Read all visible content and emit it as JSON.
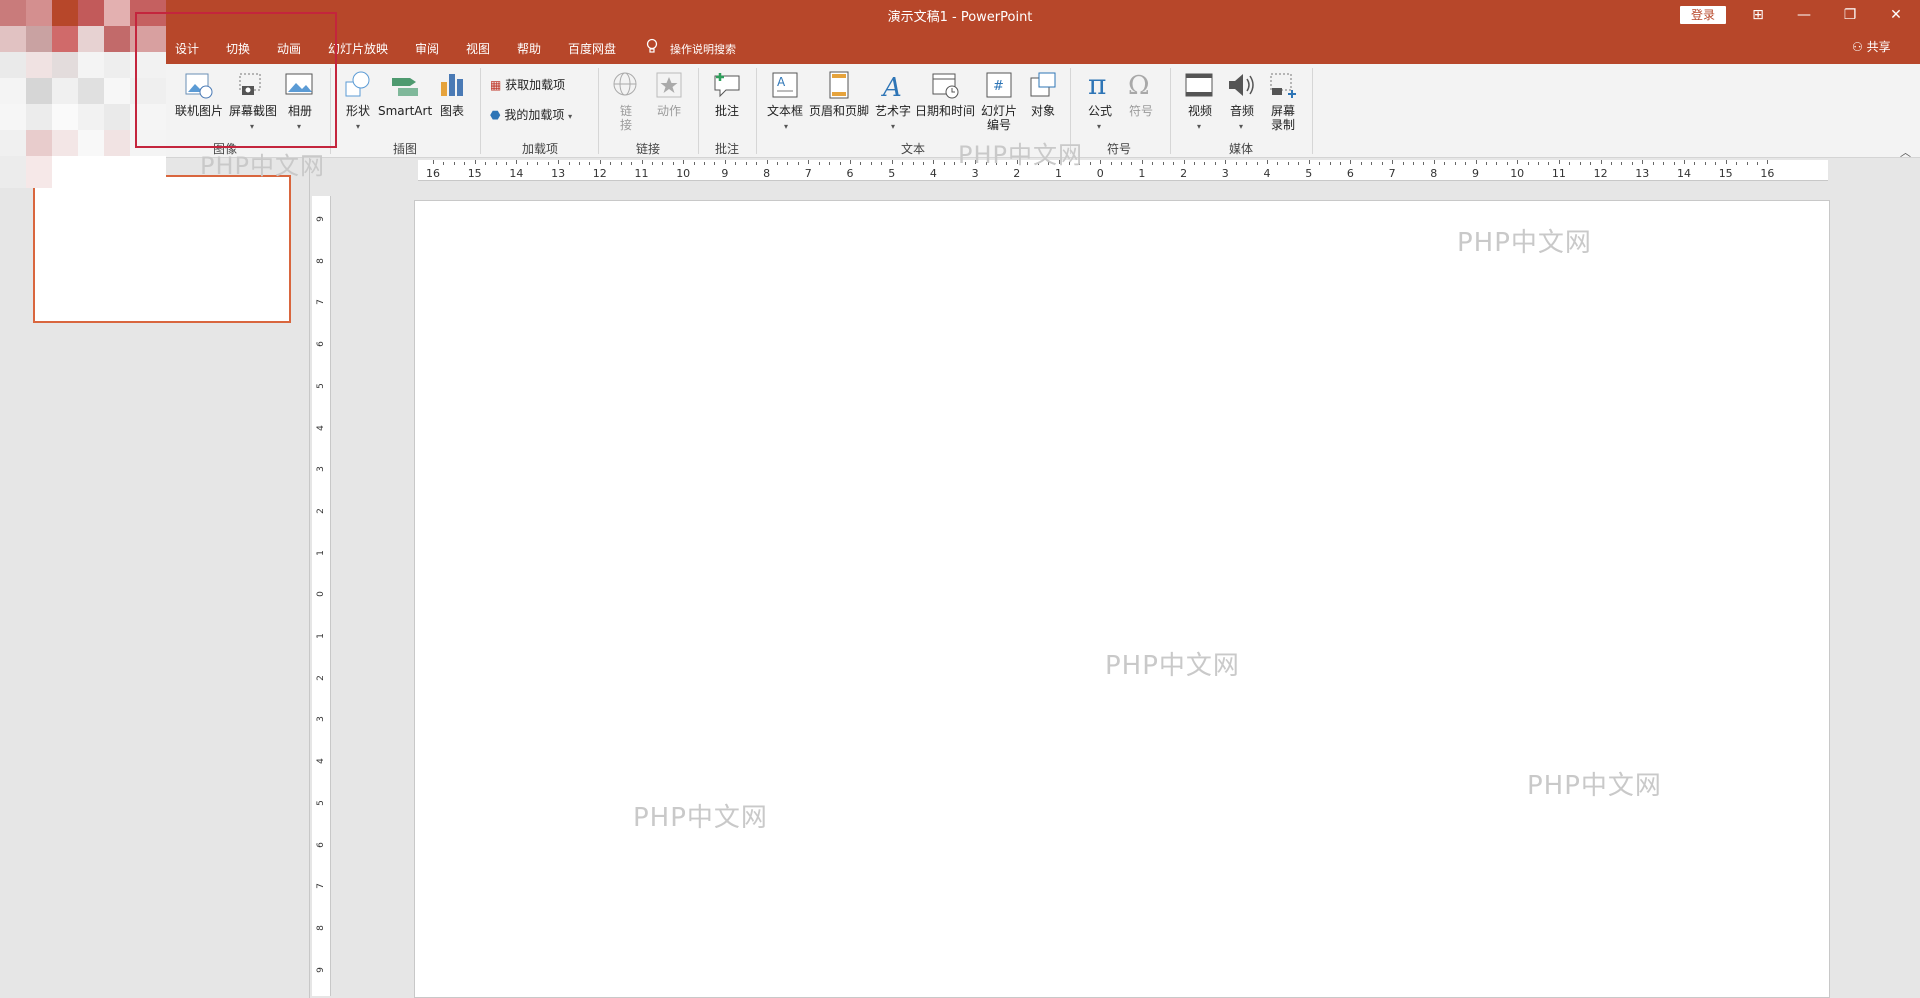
{
  "app": {
    "title": "演示文稿1  -  PowerPoint",
    "login_label": "登录",
    "share_label": "共享"
  },
  "window_controls": {
    "ribbon_options": "⊞",
    "minimize": "—",
    "restore": "❐",
    "close": "✕"
  },
  "tabs": [
    {
      "label": "设计"
    },
    {
      "label": "切换"
    },
    {
      "label": "动画"
    },
    {
      "label": "幻灯片放映"
    },
    {
      "label": "审阅"
    },
    {
      "label": "视图"
    },
    {
      "label": "帮助"
    },
    {
      "label": "百度网盘"
    }
  ],
  "tell_me": {
    "label": "操作说明搜索",
    "icon": "lightbulb-icon"
  },
  "ribbon": {
    "images": {
      "group": "图像",
      "online_pictures": "联机图片",
      "screenshot": "屏幕截图",
      "photo_album": "相册"
    },
    "illustrations": {
      "group": "插图",
      "shapes": "形状",
      "smartart": "SmartArt",
      "chart": "图表"
    },
    "addins": {
      "group": "加载项",
      "get_addins": "获取加载项",
      "my_addins": "我的加载项"
    },
    "links": {
      "group": "链接",
      "link": "链接",
      "action": "动作"
    },
    "comments": {
      "group": "批注",
      "comment": "批注"
    },
    "text": {
      "group": "文本",
      "textbox": "文本框",
      "header_footer": "页眉和页脚",
      "wordart": "艺术字",
      "date_time": "日期和时间",
      "slide_number": "幻灯片\n编号",
      "object": "对象"
    },
    "symbols": {
      "group": "符号",
      "equation": "公式",
      "symbol": "符号"
    },
    "media": {
      "group": "媒体",
      "video": "视频",
      "audio": "音频",
      "screen_recording": "屏幕\n录制"
    }
  },
  "ruler": {
    "h_labels": [
      "16",
      "15",
      "14",
      "13",
      "12",
      "11",
      "10",
      "9",
      "8",
      "7",
      "6",
      "5",
      "4",
      "3",
      "2",
      "1",
      "0",
      "1",
      "2",
      "3",
      "4",
      "5",
      "6",
      "7",
      "8",
      "9",
      "10",
      "11",
      "12",
      "13",
      "14",
      "15",
      "16"
    ],
    "v_labels": [
      "9",
      "8",
      "7",
      "6",
      "5",
      "4",
      "3",
      "2",
      "1",
      "0",
      "1",
      "2",
      "3",
      "4",
      "5",
      "6",
      "7",
      "8",
      "9"
    ]
  },
  "watermarks": [
    "PHP中文网",
    "PHP中文网",
    "PHP中文网",
    "PHP中文网",
    "PHP中文网"
  ],
  "colors": {
    "brand": "#b7472a",
    "thumb_border": "#d9663e",
    "highlight": "#c4253d"
  }
}
